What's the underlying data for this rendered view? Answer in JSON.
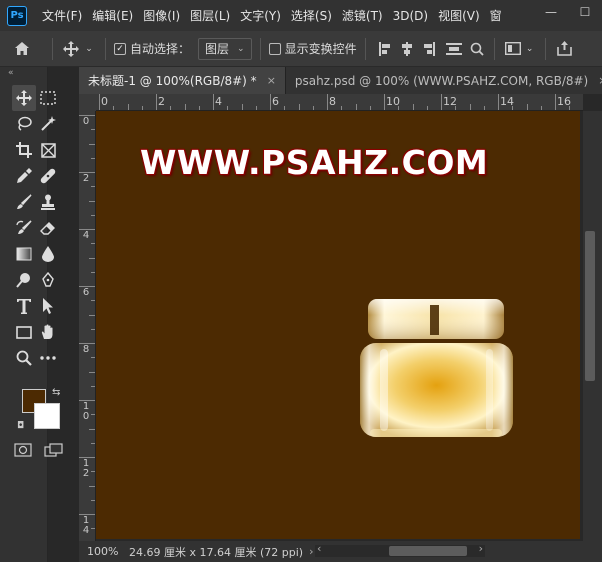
{
  "app": {
    "logo": "Ps"
  },
  "menu": [
    "文件(F)",
    "编辑(E)",
    "图像(I)",
    "图层(L)",
    "文字(Y)",
    "选择(S)",
    "滤镜(T)",
    "3D(D)",
    "视图(V)",
    "窗"
  ],
  "window_controls": {
    "minimize": "—",
    "maximize": "☐"
  },
  "options": {
    "auto_select_label": "自动选择：",
    "auto_select_checked": true,
    "auto_select_target": "图层",
    "show_transform_label": "显示变换控件",
    "show_transform_checked": false
  },
  "tabs": [
    {
      "label": "未标题-1 @ 100%(RGB/8#) *",
      "active": true
    },
    {
      "label": "psahz.psd @ 100% (WWW.PSAHZ.COM, RGB/8#)",
      "active": false
    }
  ],
  "rulers": {
    "top": [
      "0",
      "2",
      "4",
      "6",
      "8",
      "10",
      "12",
      "14",
      "16"
    ],
    "left": [
      "0",
      "2",
      "4",
      "6",
      "8",
      "10",
      "12",
      "14"
    ]
  },
  "canvas": {
    "background": "#4c2a02",
    "watermark_text": "WWW.PSAHZ.COM"
  },
  "colors": {
    "foreground": "#4c2a02",
    "background": "#ffffff",
    "accent": "#31a8ff"
  },
  "status": {
    "zoom": "100%",
    "doc_info": "24.69 厘米 x 17.64 厘米 (72 ppi)"
  }
}
